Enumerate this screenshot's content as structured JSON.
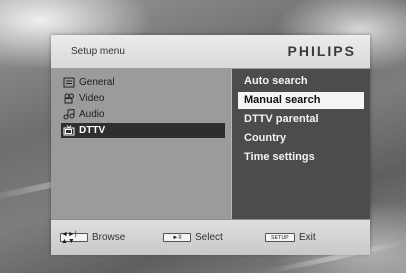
{
  "header": {
    "title": "Setup menu",
    "brand": "PHILIPS"
  },
  "categories": [
    {
      "label": "General",
      "icon": "general-icon",
      "selected": false
    },
    {
      "label": "Video",
      "icon": "video-icon",
      "selected": false
    },
    {
      "label": "Audio",
      "icon": "audio-icon",
      "selected": false
    },
    {
      "label": "DTTV",
      "icon": "dttv-icon",
      "selected": true
    }
  ],
  "submenu": [
    {
      "label": "Auto search",
      "highlighted": false
    },
    {
      "label": "Manual search",
      "highlighted": true
    },
    {
      "label": "DTTV parental",
      "highlighted": false
    },
    {
      "label": "Country",
      "highlighted": false
    },
    {
      "label": "Time settings",
      "highlighted": false
    }
  ],
  "footer": {
    "browse_key": "◄►|▲▼",
    "browse_label": "Browse",
    "select_key": "►II",
    "select_label": "Select",
    "exit_key": "SETUP",
    "exit_label": "Exit"
  },
  "colors": {
    "left_panel": "#9b9b9b",
    "right_panel": "#4c4c4c",
    "selection": "#2e2e2e",
    "highlight": "#f4f4f4"
  }
}
